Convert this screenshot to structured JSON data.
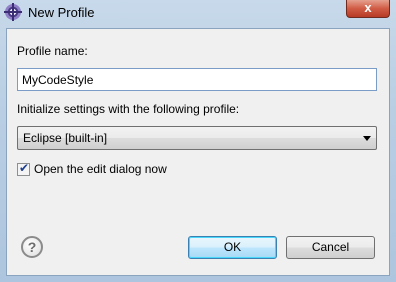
{
  "window": {
    "title": "New Profile",
    "close_glyph": "x"
  },
  "form": {
    "profile_name_label": "Profile name:",
    "profile_name_value": "MyCodeStyle",
    "initialize_label": "Initialize settings with the following profile:",
    "initialize_selected": "Eclipse [built-in]",
    "open_edit_label": "Open the edit dialog now",
    "open_edit_checked": true,
    "check_glyph": "✔"
  },
  "buttons": {
    "help_glyph": "?",
    "ok_label": "OK",
    "cancel_label": "Cancel"
  }
}
